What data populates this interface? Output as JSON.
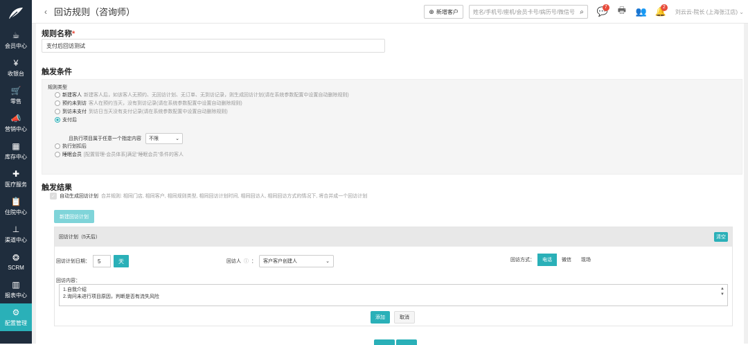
{
  "sidebar": {
    "items": [
      {
        "label": "会员中心",
        "icon": "cup-icon",
        "glyph": "☕"
      },
      {
        "label": "收银台",
        "icon": "yen-icon",
        "glyph": "¥"
      },
      {
        "label": "零售",
        "icon": "cart-icon",
        "glyph": "🛒"
      },
      {
        "label": "营销中心",
        "icon": "megaphone-icon",
        "glyph": "📣"
      },
      {
        "label": "库存中心",
        "icon": "grid-icon",
        "glyph": "▦"
      },
      {
        "label": "医疗服务",
        "icon": "medkit-icon",
        "glyph": "✚"
      },
      {
        "label": "住院中心",
        "icon": "clipboard-icon",
        "glyph": "📋"
      },
      {
        "label": "渠道中心",
        "icon": "org-chart-icon",
        "glyph": "⊥"
      },
      {
        "label": "SCRM",
        "icon": "cluster-icon",
        "glyph": "❂"
      },
      {
        "label": "报表中心",
        "icon": "bar-chart-icon",
        "glyph": "▥"
      },
      {
        "label": "配置管理",
        "icon": "gear-icon",
        "glyph": "⚙"
      }
    ]
  },
  "header": {
    "back_glyph": "‹",
    "title": "回访规则（咨询师）",
    "new_customer_label": "新增客户",
    "search_placeholder": "姓名/手机号/座机/会员卡号/病历号/微信号",
    "message_badge": "7",
    "notification_badge": "2",
    "user_label": "刘云云-院长 (上海张江店)"
  },
  "rule_name": {
    "heading": "规则名称",
    "required_mark": "*",
    "value": "支付后回访测试"
  },
  "trigger": {
    "heading": "触发条件",
    "rule_type_label": "规则类型",
    "options": [
      {
        "label": "新建客人",
        "desc": "新建客人后，如该客人无预约、无回访计划、无订单、无到访记录，则生成回访计划(请在系统参数配置中设置自动删除规则)",
        "selected": false
      },
      {
        "label": "预约未到访",
        "desc": "客人在预约当天，没有到访记录(请在系统参数配置中设置自动删除规则)",
        "selected": false
      },
      {
        "label": "到访未支付",
        "desc": "到访日当天没有支付记录(请在系统参数配置中设置自动删除规则)",
        "selected": false
      },
      {
        "label": "支付后",
        "desc": "",
        "selected": true
      },
      {
        "label": "执行划扣后",
        "desc": "",
        "selected": false
      },
      {
        "label": "睡眠会员",
        "desc": "[配置管理-会员体系]满足“睡眠会员”条件的客人",
        "selected": false
      }
    ],
    "sub_condition_label": "且执行项目属于任意一个指定内容",
    "sub_condition_value": "不限"
  },
  "result": {
    "heading": "触发结果",
    "auto_label": "自动生成回访计划",
    "auto_desc": "合并规则: 相同门店, 相同客户, 相同规则类型, 相同回访计划时间, 相同回访人, 相同回访方式的情况下, 将合并成一个回访计划",
    "new_plan_button": "新建回访计划"
  },
  "plan": {
    "header": "回访计划（5天后）",
    "clear_button": "清空",
    "date_label": "回访计划日期：",
    "days_value": "5",
    "days_unit": "天",
    "visitor_label": "回访人",
    "visitor_value": "客户客户创建人",
    "method_label": "回访方式：",
    "methods": [
      {
        "label": "电话",
        "selected": true
      },
      {
        "label": "微信",
        "selected": false
      },
      {
        "label": "现场",
        "selected": false
      }
    ],
    "content_label": "回访内容：",
    "content_lines": [
      "1.自我介绍",
      "2.询问未进行项目原因，判断是否有流失风险"
    ],
    "add_button": "添加",
    "cancel_button": "取消"
  },
  "colors": {
    "accent": "#2ab0b8",
    "sidebar": "#1f2d3d",
    "badge": "#e74c3c"
  }
}
